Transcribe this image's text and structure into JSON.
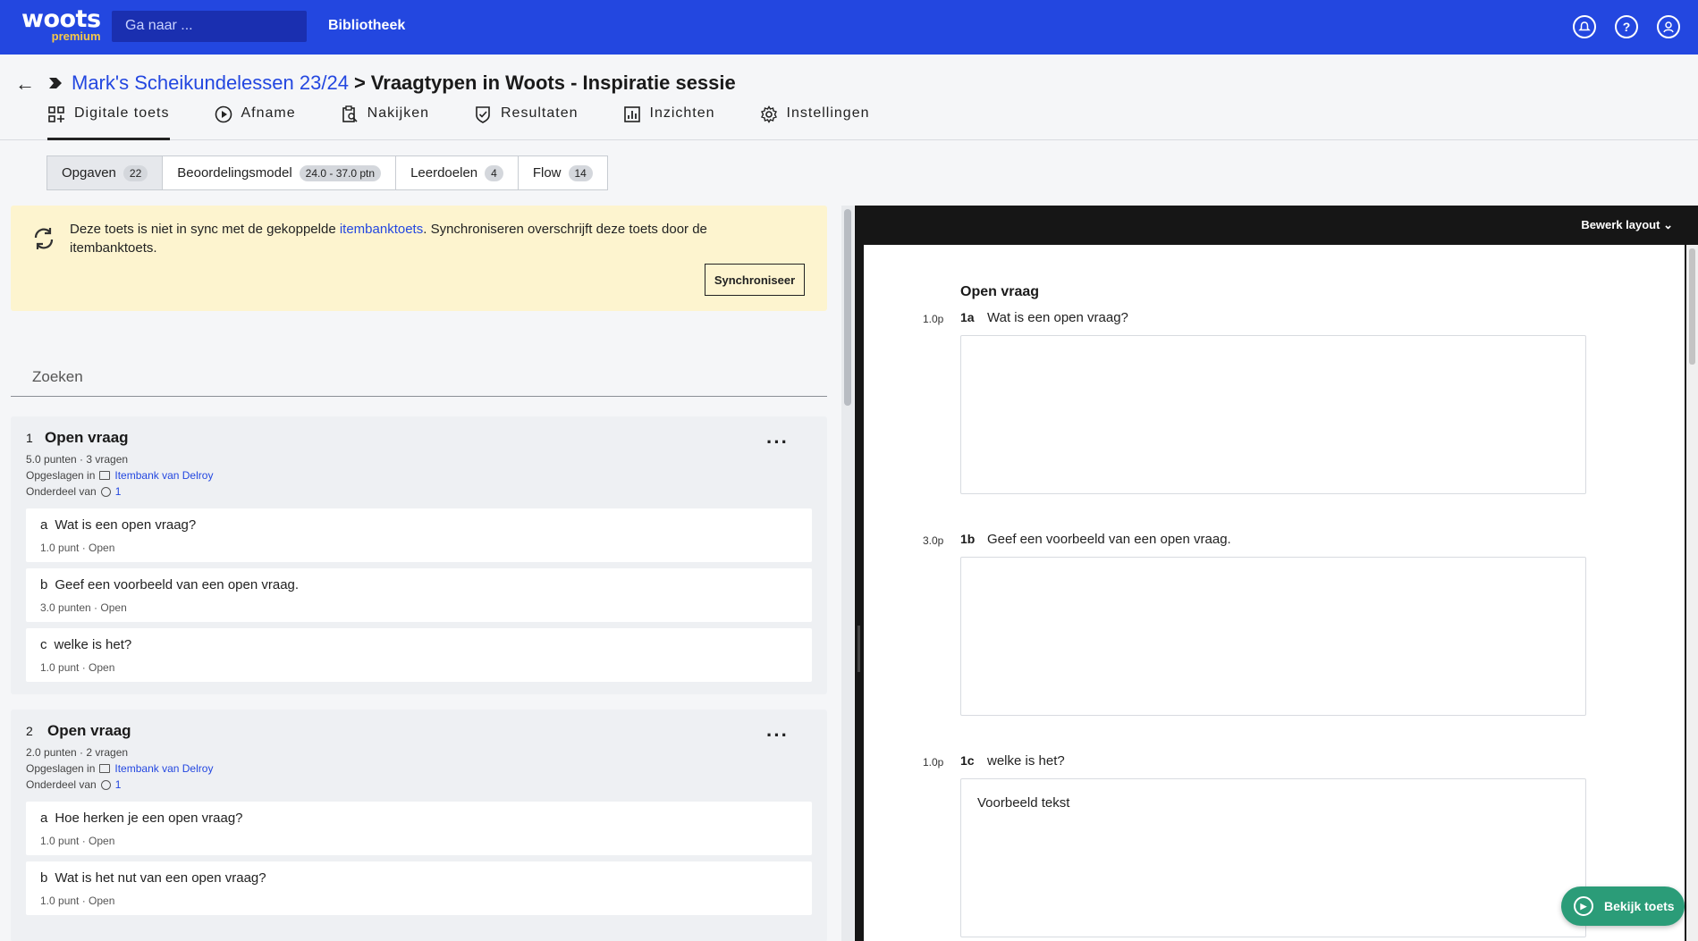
{
  "topbar": {
    "logo_main": "woots",
    "logo_sub": "premium",
    "search_placeholder": "Ga naar ...",
    "library_link": "Bibliotheek",
    "icons": [
      "notifications-icon",
      "help-icon",
      "account-icon"
    ]
  },
  "header": {
    "breadcrumb_parent": "Mark's Scheikundelessen 23/24",
    "breadcrumb_separator": ">",
    "breadcrumb_current": "Vraagtypen in Woots - Inspiratie sessie",
    "tabs": [
      {
        "label": "Digitale toets",
        "icon": "grid-icon",
        "active": true
      },
      {
        "label": "Afname",
        "icon": "play-icon",
        "active": false
      },
      {
        "label": "Nakijken",
        "icon": "clipboard-search-icon",
        "active": false
      },
      {
        "label": "Resultaten",
        "icon": "shield-check-icon",
        "active": false
      },
      {
        "label": "Inzichten",
        "icon": "bar-chart-icon",
        "active": false
      },
      {
        "label": "Instellingen",
        "icon": "gear-icon",
        "active": false
      }
    ]
  },
  "subtabs": [
    {
      "label": "Opgaven",
      "badge": "22",
      "active": true
    },
    {
      "label": "Beoordelingsmodel",
      "badge": "24.0 - 37.0 ptn",
      "active": false
    },
    {
      "label": "Leerdoelen",
      "badge": "4",
      "active": false
    },
    {
      "label": "Flow",
      "badge": "14",
      "active": false
    }
  ],
  "sync": {
    "text_before": "Deze toets is niet in sync met de gekoppelde ",
    "link": "itembanktoets",
    "text_after": ". Synchroniseren overschrijft deze toets door de itembanktoets.",
    "button": "Synchroniseer"
  },
  "search_label": "Zoeken",
  "questions": [
    {
      "number": "1",
      "title": "Open vraag",
      "meta": "5.0 punten · 3 vragen",
      "saved_label": "Opgeslagen in",
      "saved_link": "Itembank van Delroy",
      "part_label": "Onderdeel van",
      "part_link": "1",
      "subs": [
        {
          "letter": "a",
          "text": "Wat is een open vraag?",
          "meta": "1.0 punt · Open"
        },
        {
          "letter": "b",
          "text": "Geef een voorbeeld van een open vraag.",
          "meta": "3.0 punten · Open"
        },
        {
          "letter": "c",
          "text": "welke is het?",
          "meta": "1.0 punt · Open"
        }
      ]
    },
    {
      "number": "2",
      "title": "Open vraag",
      "meta": "2.0 punten · 2 vragen",
      "saved_label": "Opgeslagen in",
      "saved_link": "Itembank van Delroy",
      "part_label": "Onderdeel van",
      "part_link": "1",
      "subs": [
        {
          "letter": "a",
          "text": "Hoe herken je een open vraag?",
          "meta": "1.0 punt · Open"
        },
        {
          "letter": "b",
          "text": "Wat is het nut van een open vraag?",
          "meta": "1.0 punt · Open"
        }
      ]
    }
  ],
  "preview": {
    "layout_button": "Bewerk layout",
    "heading": "Open vraag",
    "items": [
      {
        "points": "1.0p",
        "num": "1a",
        "text": "Wat is een open vraag?",
        "answer": ""
      },
      {
        "points": "3.0p",
        "num": "1b",
        "text": "Geef een voorbeeld van een open vraag.",
        "answer": ""
      },
      {
        "points": "1.0p",
        "num": "1c",
        "text": "welke is het?",
        "answer": "Voorbeeld tekst"
      }
    ]
  },
  "fab_label": "Bekijk toets"
}
